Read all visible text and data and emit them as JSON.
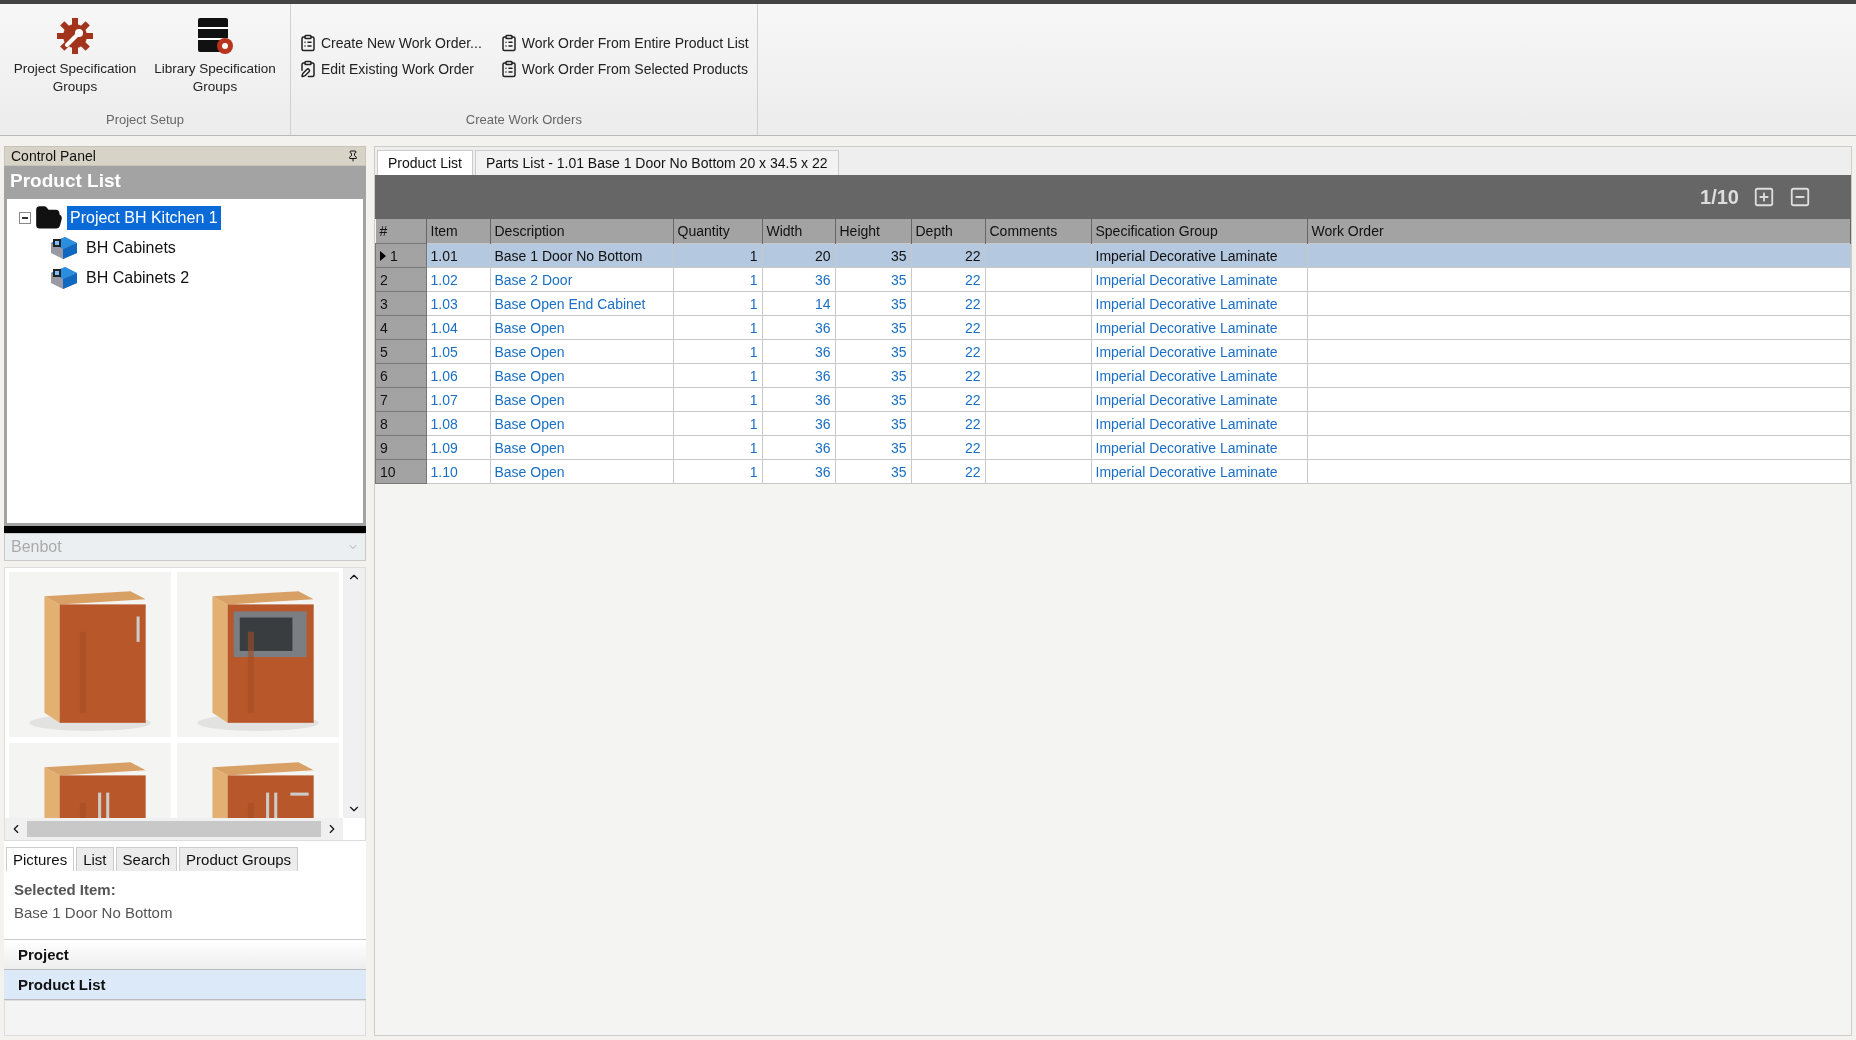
{
  "ribbon": {
    "groups": [
      {
        "label": "Project Setup",
        "buttons": [
          {
            "kind": "large",
            "label": "Project Specification Groups"
          },
          {
            "kind": "large",
            "label": "Library Specification Groups"
          }
        ]
      },
      {
        "label": "Create Work Orders",
        "buttons": [
          {
            "kind": "small",
            "label": "Create New Work Order..."
          },
          {
            "kind": "small",
            "label": "Edit Existing Work Order"
          },
          {
            "kind": "small",
            "label": "Work Order From Entire Product List"
          },
          {
            "kind": "small",
            "label": "Work Order From Selected Products"
          }
        ]
      }
    ]
  },
  "control_panel": {
    "title": "Control Panel",
    "heading": "Product List",
    "tree": [
      {
        "label": "Project BH Kitchen 1",
        "kind": "project",
        "selected": true,
        "expanded": true,
        "children": [
          {
            "label": "BH Cabinets",
            "kind": "room",
            "selected": false
          },
          {
            "label": "BH Cabinets 2",
            "kind": "room",
            "selected": false
          }
        ]
      }
    ],
    "library_dropdown": {
      "value": "Benbot"
    },
    "tabs": [
      {
        "label": "Pictures",
        "selected": true
      },
      {
        "label": "List",
        "selected": false
      },
      {
        "label": "Search",
        "selected": false
      },
      {
        "label": "Product Groups",
        "selected": false
      }
    ],
    "selected_item": {
      "label": "Selected Item:",
      "value": "Base 1 Door No Bottom"
    },
    "nav": [
      {
        "label": "Project",
        "selected": false
      },
      {
        "label": "Product List",
        "selected": true
      }
    ]
  },
  "document_tabs": [
    {
      "label": "Product List",
      "selected": true
    },
    {
      "label": "Parts List - 1.01 Base 1 Door No Bottom 20 x 34.5 x 22",
      "selected": false
    }
  ],
  "pager": {
    "text": "1/10"
  },
  "table": {
    "columns": [
      "#",
      "Item",
      "Description",
      "Quantity",
      "Width",
      "Height",
      "Depth",
      "Comments",
      "Specification Group",
      "Work Order"
    ],
    "rows": [
      {
        "selected": true,
        "cells": [
          "1",
          "1.01",
          "Base 1 Door No Bottom",
          "1",
          "20",
          "35",
          "22",
          "",
          "Imperial Decorative Laminate",
          ""
        ]
      },
      {
        "selected": false,
        "cells": [
          "2",
          "1.02",
          "Base 2 Door",
          "1",
          "36",
          "35",
          "22",
          "",
          "Imperial Decorative Laminate",
          ""
        ]
      },
      {
        "selected": false,
        "cells": [
          "3",
          "1.03",
          "Base Open End Cabinet",
          "1",
          "14",
          "35",
          "22",
          "",
          "Imperial Decorative Laminate",
          ""
        ]
      },
      {
        "selected": false,
        "cells": [
          "4",
          "1.04",
          "Base Open",
          "1",
          "36",
          "35",
          "22",
          "",
          "Imperial Decorative Laminate",
          ""
        ]
      },
      {
        "selected": false,
        "cells": [
          "5",
          "1.05",
          "Base Open",
          "1",
          "36",
          "35",
          "22",
          "",
          "Imperial Decorative Laminate",
          ""
        ]
      },
      {
        "selected": false,
        "cells": [
          "6",
          "1.06",
          "Base Open",
          "1",
          "36",
          "35",
          "22",
          "",
          "Imperial Decorative Laminate",
          ""
        ]
      },
      {
        "selected": false,
        "cells": [
          "7",
          "1.07",
          "Base Open",
          "1",
          "36",
          "35",
          "22",
          "",
          "Imperial Decorative Laminate",
          ""
        ]
      },
      {
        "selected": false,
        "cells": [
          "8",
          "1.08",
          "Base Open",
          "1",
          "36",
          "35",
          "22",
          "",
          "Imperial Decorative Laminate",
          ""
        ]
      },
      {
        "selected": false,
        "cells": [
          "9",
          "1.09",
          "Base Open",
          "1",
          "36",
          "35",
          "22",
          "",
          "Imperial Decorative Laminate",
          ""
        ]
      },
      {
        "selected": false,
        "cells": [
          "10",
          "1.10",
          "Base Open",
          "1",
          "36",
          "35",
          "22",
          "",
          "Imperial Decorative Laminate",
          ""
        ]
      }
    ]
  }
}
